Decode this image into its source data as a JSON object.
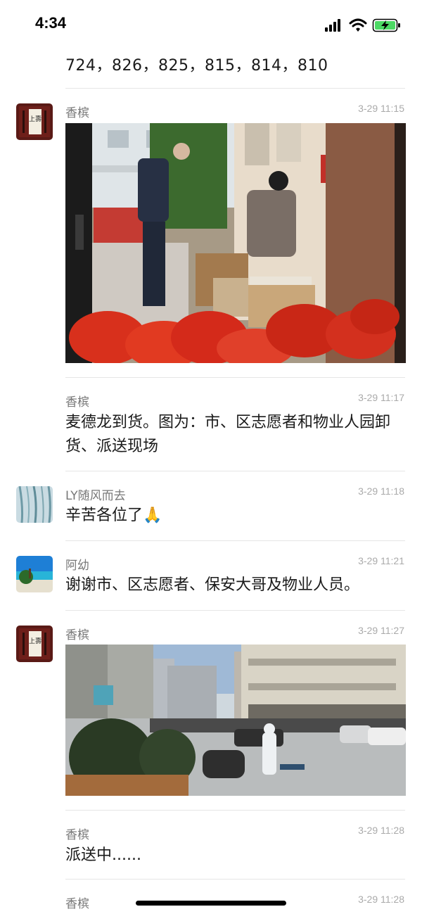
{
  "status_bar": {
    "time": "4:34"
  },
  "top_message": {
    "text": "724，826，825，815，814，810"
  },
  "messages": [
    {
      "sender": "香槟",
      "time": "3-29 11:15",
      "type": "image"
    },
    {
      "sender": "香槟",
      "time": "3-29 11:17",
      "text": "麦德龙到货。图为：市、区志愿者和物业人园卸货、派送现场"
    },
    {
      "sender": "LY随风而去",
      "time": "3-29 11:18",
      "text": "辛苦各位了🙏"
    },
    {
      "sender": "阿幼",
      "time": "3-29 11:21",
      "text": "谢谢市、区志愿者、保安大哥及物业人员。"
    },
    {
      "sender": "香槟",
      "time": "3-29 11:27",
      "type": "image"
    },
    {
      "sender": "香槟",
      "time": "3-29 11:28",
      "text": "派送中......"
    },
    {
      "sender": "香槟",
      "time": "3-29 11:28"
    }
  ],
  "avatar_text": "上壽",
  "colors": {
    "background": "#ffffff",
    "meta": "#999999",
    "divider": "#e6e6e6",
    "battery": "#4cd964"
  }
}
